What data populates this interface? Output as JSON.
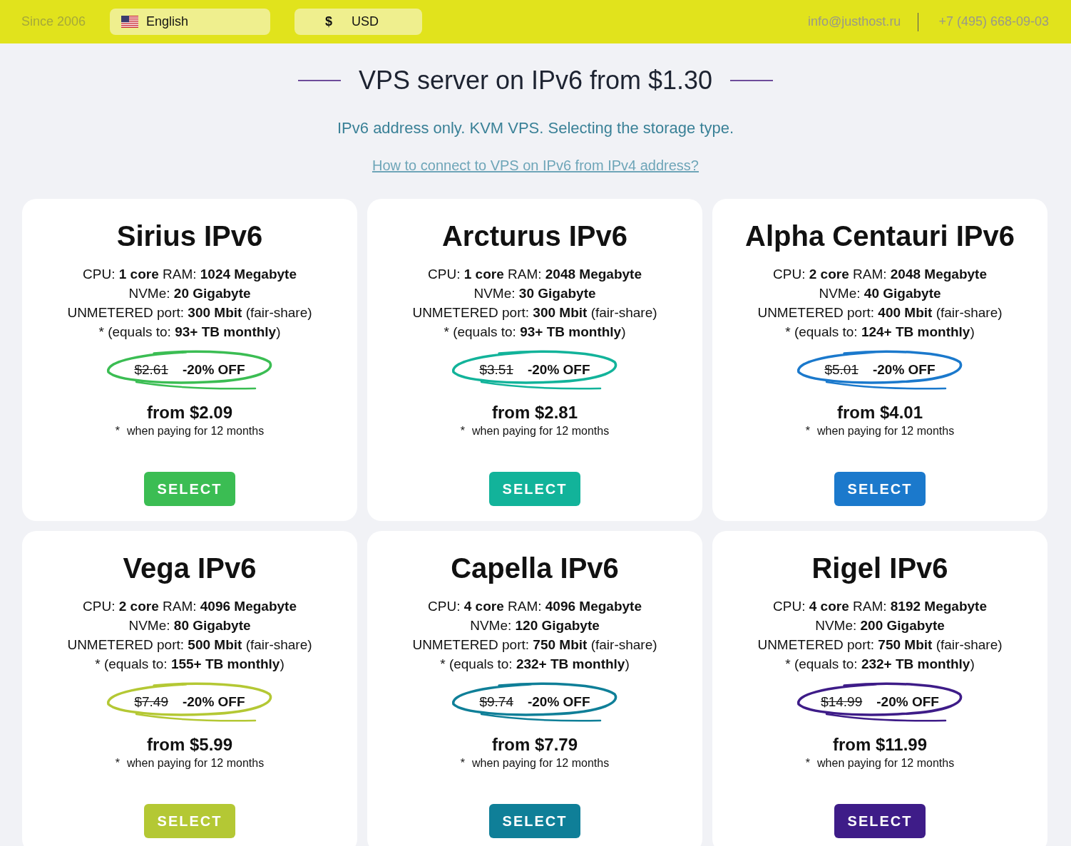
{
  "top_bar": {
    "since": "Since 2006",
    "language": {
      "label": "English"
    },
    "currency": {
      "symbol": "$",
      "label": "USD"
    },
    "email": "info@justhost.ru",
    "phone": "+7 (495) 668-09-03"
  },
  "header": {
    "title": "VPS server on IPv6 from $1.30",
    "subtitle": "IPv6 address only. KVM VPS. Selecting the storage type.",
    "link": "How to connect to VPS on IPv6 from IPv4 address?"
  },
  "plans": [
    {
      "name": "Sirius IPv6",
      "color": "#3bbd53",
      "specs": [
        "CPU: **1 core** RAM: **1024 Megabyte**",
        "NVMe: **20 Gigabyte**",
        "UNMETERED port: **300 Mbit** (fair-share)",
        "* (equals to: **93+ TB monthly**)"
      ],
      "old_price": "$2.61",
      "discount": "-20% OFF",
      "price": "from $2.09",
      "note_mark": "*",
      "note": "when paying for 12 months",
      "button": "SELECT"
    },
    {
      "name": "Arcturus IPv6",
      "color": "#12b39a",
      "specs": [
        "CPU: **1 core** RAM: **2048 Megabyte**",
        "NVMe: **30 Gigabyte**",
        "UNMETERED port: **300 Mbit** (fair-share)",
        "* (equals to: **93+ TB monthly**)"
      ],
      "old_price": "$3.51",
      "discount": "-20% OFF",
      "price": "from $2.81",
      "note_mark": "*",
      "note": "when paying for 12 months",
      "button": "SELECT"
    },
    {
      "name": "Alpha Centauri IPv6",
      "color": "#1b79cc",
      "specs": [
        "CPU: **2 core** RAM: **2048 Megabyte**",
        "NVMe: **40 Gigabyte**",
        "UNMETERED port: **400 Mbit** (fair-share)",
        "* (equals to: **124+ TB monthly**)"
      ],
      "old_price": "$5.01",
      "discount": "-20% OFF",
      "price": "from $4.01",
      "note_mark": "*",
      "note": "when paying for 12 months",
      "button": "SELECT"
    },
    {
      "name": "Vega IPv6",
      "color": "#b4c834",
      "specs": [
        "CPU: **2 core** RAM: **4096 Megabyte**",
        "NVMe: **80 Gigabyte**",
        "UNMETERED port: **500 Mbit** (fair-share)",
        "* (equals to: **155+ TB monthly**)"
      ],
      "old_price": "$7.49",
      "discount": "-20% OFF",
      "price": "from $5.99",
      "note_mark": "*",
      "note": "when paying for 12 months",
      "button": "SELECT"
    },
    {
      "name": "Capella IPv6",
      "color": "#0f7f98",
      "specs": [
        "CPU: **4 core** RAM: **4096 Megabyte**",
        "NVMe: **120 Gigabyte**",
        "UNMETERED port: **750 Mbit** (fair-share)",
        "* (equals to: **232+ TB monthly**)"
      ],
      "old_price": "$9.74",
      "discount": "-20% OFF",
      "price": "from $7.79",
      "note_mark": "*",
      "note": "when paying for 12 months",
      "button": "SELECT"
    },
    {
      "name": "Rigel IPv6",
      "color": "#3e1c88",
      "specs": [
        "CPU: **4 core** RAM: **8192 Megabyte**",
        "NVMe: **200 Gigabyte**",
        "UNMETERED port: **750 Mbit** (fair-share)",
        "* (equals to: **232+ TB monthly**)"
      ],
      "old_price": "$14.99",
      "discount": "-20% OFF",
      "price": "from $11.99",
      "note_mark": "*",
      "note": "when paying for 12 months",
      "button": "SELECT"
    }
  ]
}
